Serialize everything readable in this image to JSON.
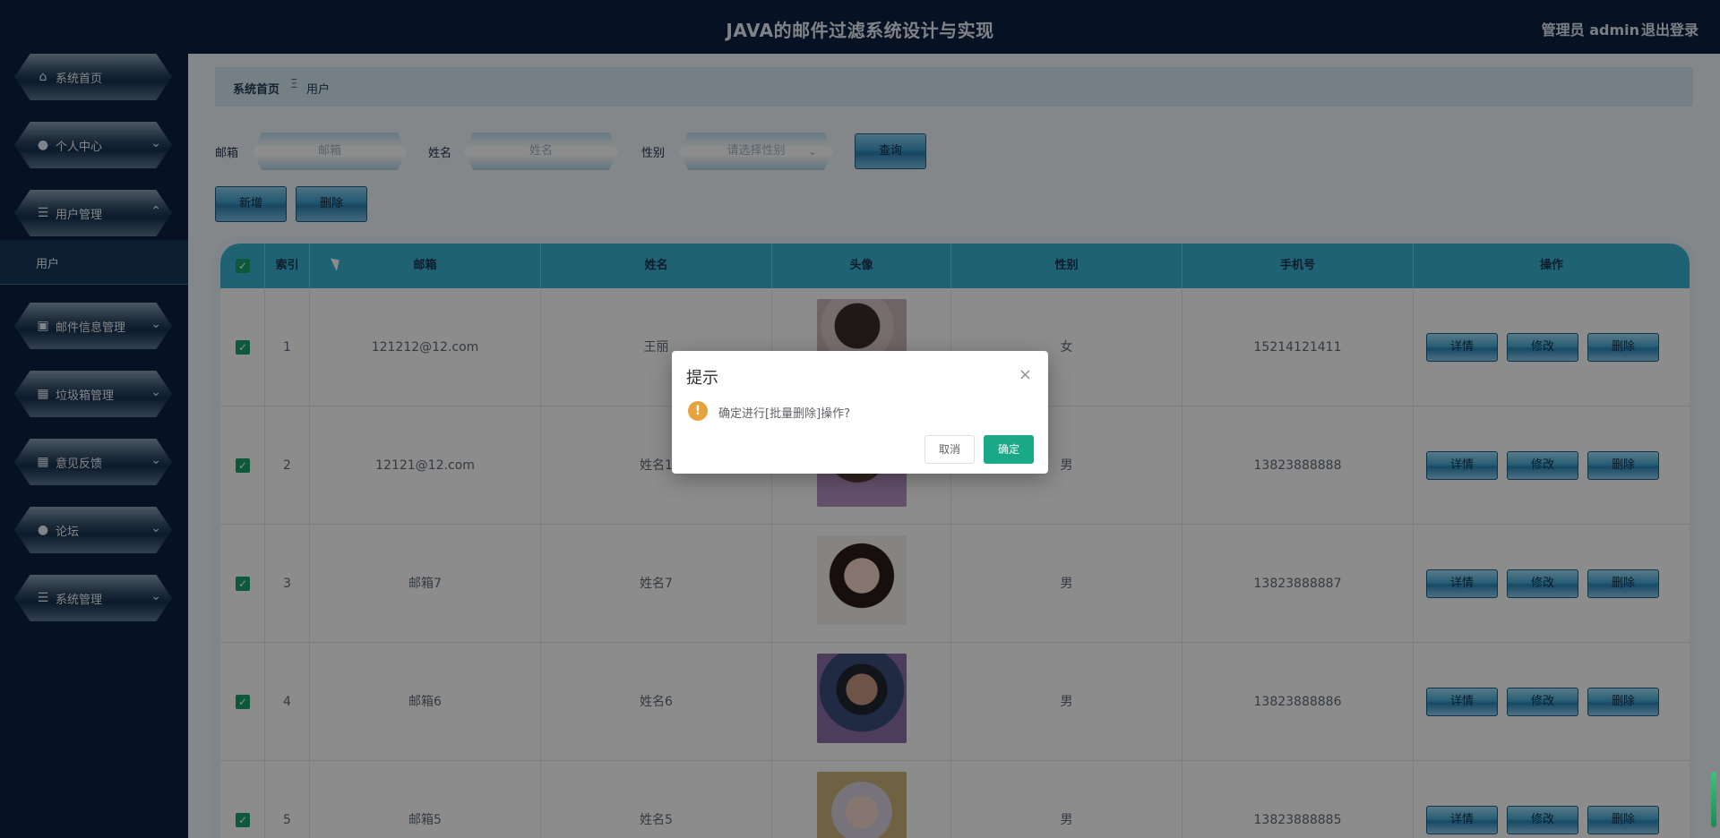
{
  "header": {
    "title": "JAVA的邮件过滤系统设计与实现",
    "user": "管理员 admin",
    "logout": "退出登录"
  },
  "sidebar": {
    "items": [
      {
        "label": "系统首页",
        "icon": "home-icon"
      },
      {
        "label": "个人中心",
        "icon": "user-icon"
      },
      {
        "label": "用户管理",
        "icon": "list-icon"
      },
      {
        "label": "邮件信息管理",
        "icon": "clipboard-icon"
      },
      {
        "label": "垃圾箱管理",
        "icon": "grid-icon"
      },
      {
        "label": "意见反馈",
        "icon": "grid-icon"
      },
      {
        "label": "论坛",
        "icon": "user-icon"
      },
      {
        "label": "系统管理",
        "icon": "list-icon"
      }
    ],
    "submenu_label": "用户"
  },
  "breadcrumb": {
    "home": "系统首页",
    "sep": "Ξ",
    "current": "用户"
  },
  "filters": {
    "email_label": "邮箱",
    "email_placeholder": "邮箱",
    "name_label": "姓名",
    "name_placeholder": "姓名",
    "gender_label": "性别",
    "gender_placeholder": "请选择性别",
    "query_button": "查询"
  },
  "toolbar": {
    "add_button": "新增",
    "delete_button": "删除"
  },
  "table": {
    "headers": {
      "index": "索引",
      "email": "邮箱",
      "name": "姓名",
      "avatar": "头像",
      "gender": "性别",
      "phone": "手机号",
      "actions": "操作"
    },
    "rows": [
      {
        "index": "1",
        "email": "121212@12.com",
        "name": "王丽",
        "gender": "女",
        "phone": "15214121411"
      },
      {
        "index": "2",
        "email": "12121@12.com",
        "name": "姓名1",
        "gender": "男",
        "phone": "13823888888"
      },
      {
        "index": "3",
        "email": "邮箱7",
        "name": "姓名7",
        "gender": "男",
        "phone": "13823888887"
      },
      {
        "index": "4",
        "email": "邮箱6",
        "name": "姓名6",
        "gender": "男",
        "phone": "13823888886"
      },
      {
        "index": "5",
        "email": "邮箱5",
        "name": "姓名5",
        "gender": "男",
        "phone": "13823888885"
      }
    ],
    "actions": {
      "detail": "详情",
      "edit": "修改",
      "delete": "删除"
    }
  },
  "dialog": {
    "title": "提示",
    "message": "确定进行[批量删除]操作?",
    "cancel": "取消",
    "confirm": "确定"
  },
  "colors": {
    "header_bg": "#0b2140",
    "table_header": "#3ab3d4",
    "confirm": "#1aa987",
    "warning": "#e6a23c"
  }
}
